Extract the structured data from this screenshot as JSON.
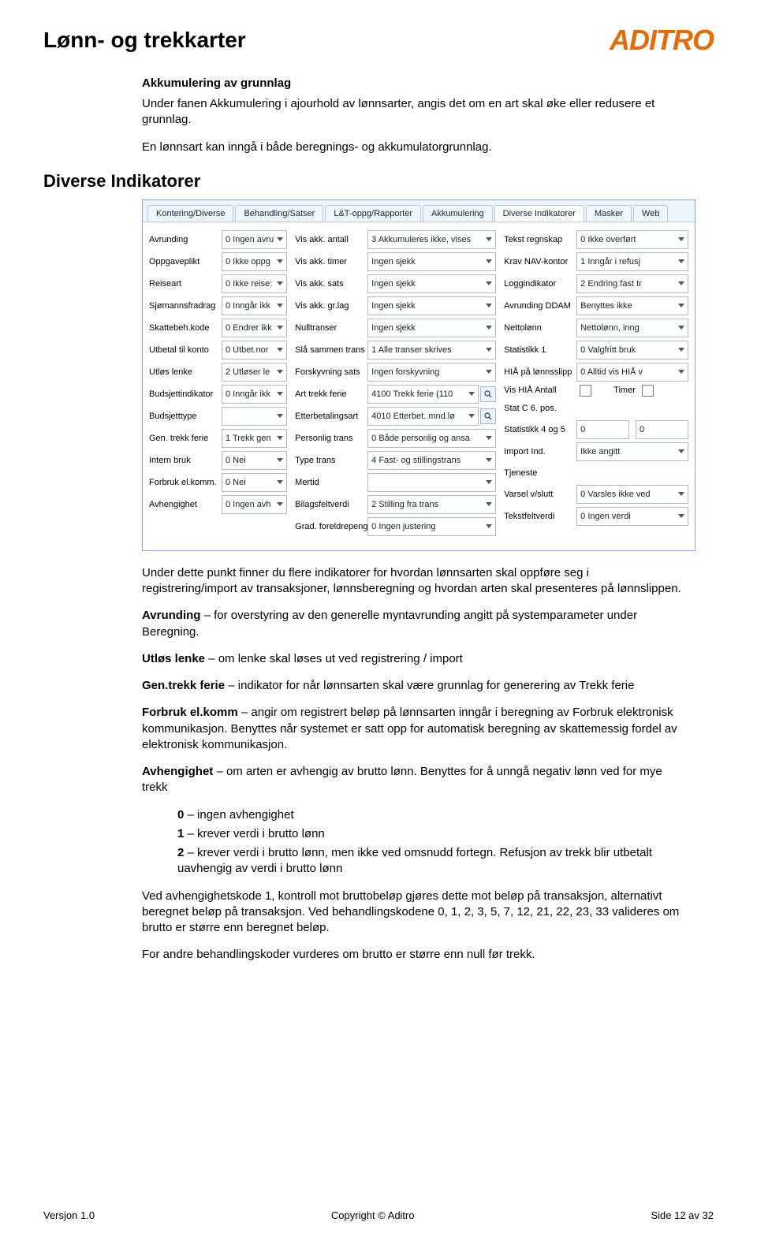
{
  "header": {
    "title": "Lønn- og trekkarter",
    "logo": "ADITRO"
  },
  "section1": {
    "heading": "Akkumulering av grunnlag",
    "p1": "Under fanen Akkumulering i ajourhold av lønnsarter, angis det om en art skal øke eller redusere et grunnlag.",
    "p2": "En lønnsart kan inngå i både beregnings- og akkumulatorgrunnlag."
  },
  "section2": {
    "heading": "Diverse Indikatorer"
  },
  "screenshot": {
    "tabs": [
      "Kontering/Diverse",
      "Behandling/Satser",
      "L&T-oppg/Rapporter",
      "Akkumulering",
      "Diverse Indikatorer",
      "Masker",
      "Web"
    ],
    "active_tab": 4,
    "col1": [
      {
        "label": "Avrunding",
        "value": "0 Ingen avru"
      },
      {
        "label": "Oppgaveplikt",
        "value": "0 Ikke oppg"
      },
      {
        "label": "Reiseart",
        "value": "0 Ikke reise:"
      },
      {
        "label": "Sjømannsfradrag",
        "value": "0 Inngår ikk"
      },
      {
        "label": "Skattebeh.kode",
        "value": "0 Endrer ikk"
      },
      {
        "label": "Utbetal til konto",
        "value": "0 Utbet.nor"
      },
      {
        "label": "Utløs lenke",
        "value": "2 Utløser le"
      },
      {
        "label": "Budsjettindikator",
        "value": "0 Inngår ikk"
      },
      {
        "label": "Budsjetttype",
        "value": ""
      },
      {
        "label": "Gen. trekk ferie",
        "value": "1 Trekk gen"
      },
      {
        "label": "Intern bruk",
        "value": "0 Nei"
      },
      {
        "label": "Forbruk el.komm.",
        "value": "0 Nei"
      },
      {
        "label": "Avhengighet",
        "value": "0 Ingen avh"
      }
    ],
    "col2": [
      {
        "label": "Vis akk. antall",
        "value": "3 Akkumuleres ikke, vises"
      },
      {
        "label": "Vis akk. timer",
        "value": "Ingen sjekk"
      },
      {
        "label": "Vis akk. sats",
        "value": "Ingen sjekk"
      },
      {
        "label": "Vis akk. gr.lag",
        "value": "Ingen sjekk"
      },
      {
        "label": "Nulltranser",
        "value": "Ingen sjekk"
      },
      {
        "label": "Slå sammen trans",
        "value": "1 Alle transer skrives"
      },
      {
        "label": "Forskyvning sats",
        "value": "Ingen forskyvning"
      },
      {
        "label": "Art trekk ferie",
        "value": "4100 Trekk ferie (110",
        "search": true
      },
      {
        "label": "Etterbetalingsart",
        "value": "4010 Etterbet. mnd.lø",
        "search": true
      },
      {
        "label": "Personlig trans",
        "value": "0 Både personlig og ansa"
      },
      {
        "label": "Type trans",
        "value": "4 Fast- og stillingstrans"
      },
      {
        "label": "Mertid",
        "value": ""
      },
      {
        "label": "Bilagsfeltverdi",
        "value": "2 Stilling fra trans"
      },
      {
        "label": "Grad. foreldrepeng",
        "value": "0 Ingen justering"
      }
    ],
    "col3_labels": [
      "Tekst regnskap",
      "Krav NAV-kontor",
      "Loggindikator",
      "Avrunding DDAM",
      "Nettolønn",
      "Statistikk 1",
      "HIÅ på lønnsslipp",
      "Vis HIÅ Antall",
      "Stat C 6. pos.",
      "Statistikk 4 og 5",
      "Import Ind.",
      "Tjeneste",
      "Varsel v/slutt",
      "Tekstfeltverdi"
    ],
    "col4": [
      {
        "value": "0 Ikke overført"
      },
      {
        "value": "1 Inngår i refusj"
      },
      {
        "value": "2 Endring fast tr"
      },
      {
        "value": "Benyttes ikke"
      },
      {
        "value": "Nettolønn, inng"
      },
      {
        "value": "0 Valgfritt bruk"
      },
      {
        "value": "0 Alltid vis HIÅ v"
      },
      {
        "checkboxes": true,
        "cb1_label": "",
        "cb2_label": "Timer"
      },
      {
        "blank": true
      },
      {
        "dual": true,
        "v1": "0",
        "v2": "0"
      },
      {
        "value": "Ikke angitt"
      },
      {
        "blank": true
      },
      {
        "value": "0 Varsles ikke ved"
      },
      {
        "value": "0 Ingen verdi"
      }
    ]
  },
  "body": {
    "p1": "Under dette punkt finner du flere indikatorer for hvordan lønnsarten skal oppføre seg i registrering/import av transaksjoner, lønnsberegning og hvordan arten skal presenteres på lønnslippen.",
    "p2a": "Avrunding",
    "p2b": " – for overstyring av den generelle myntavrunding angitt på systemparameter under Beregning.",
    "p3a": "Utløs lenke",
    "p3b": " – om lenke skal løses ut ved registrering / import",
    "p4a": "Gen.trekk ferie",
    "p4b": " – indikator for når lønnsarten skal være grunnlag for generering av Trekk ferie",
    "p5a": "Forbruk el.komm",
    "p5b": " – angir om registrert beløp på lønnsarten inngår i beregning av Forbruk elektronisk kommunikasjon. Benyttes når systemet er satt opp for automatisk beregning av skattemessig fordel av elektronisk kommunikasjon.",
    "p6a": "Avhengighet",
    "p6b": " – om arten er avhengig av brutto lønn. Benyttes for å unngå negativ lønn ved for mye trekk",
    "li0a": "0",
    "li0b": " – ingen avhengighet",
    "li1a": "1",
    "li1b": " – krever verdi i brutto lønn",
    "li2a": "2",
    "li2b": " – krever verdi i brutto lønn, men ikke ved omsnudd fortegn. Refusjon av trekk blir utbetalt uavhengig av verdi i brutto lønn",
    "p7": "Ved avhengighetskode 1, kontroll mot bruttobeløp gjøres dette mot beløp på transaksjon, alternativt beregnet beløp på transaksjon. Ved behandlingskodene 0, 1, 2, 3, 5, 7, 12, 21, 22, 23, 33 valideres om brutto er større enn beregnet beløp.",
    "p8": "For andre behandlingskoder vurderes om brutto er større enn null før trekk."
  },
  "footer": {
    "left": "Versjon 1.0",
    "center": "Copyright © Aditro",
    "right": "Side 12 av 32"
  }
}
